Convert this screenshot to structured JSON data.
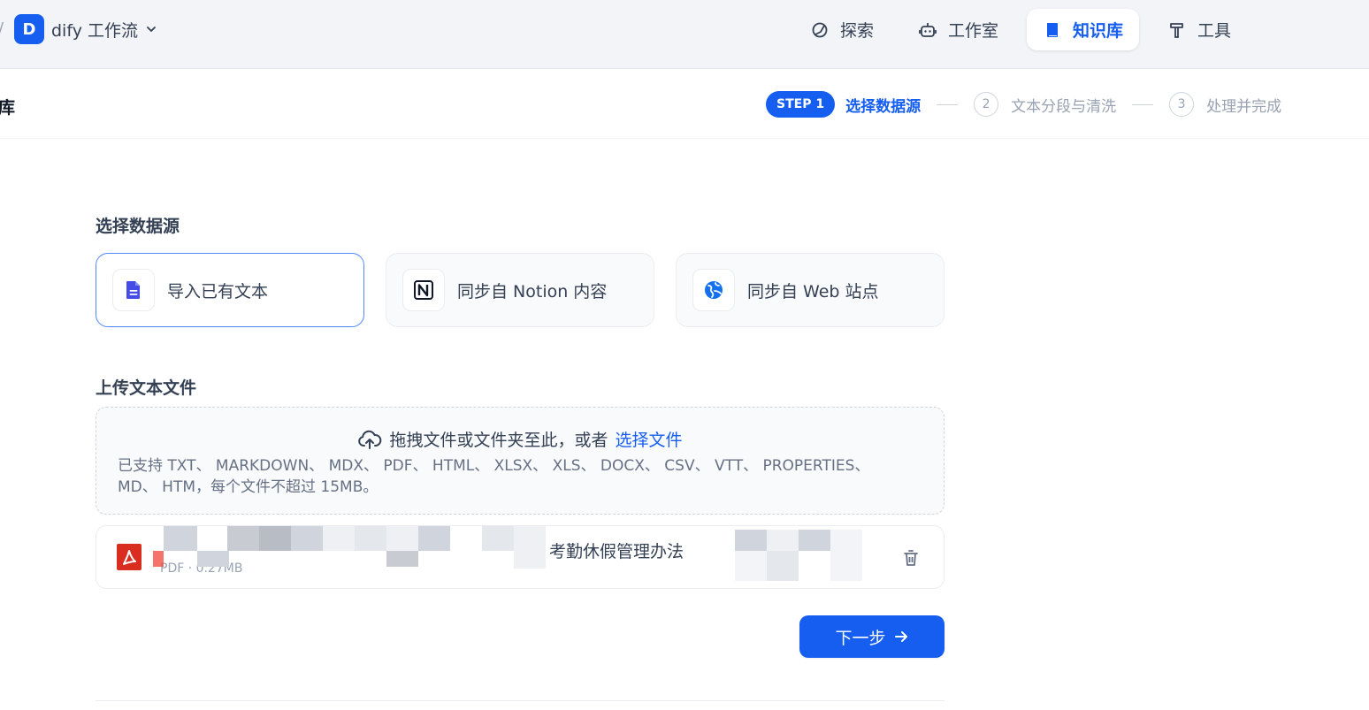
{
  "header": {
    "app_name": "dify 工作流",
    "app_initial": "D",
    "nav": [
      {
        "label": "探索",
        "icon": "compass-icon",
        "active": false
      },
      {
        "label": "工作室",
        "icon": "robot-icon",
        "active": false
      },
      {
        "label": "知识库",
        "icon": "book-icon",
        "active": true
      },
      {
        "label": "工具",
        "icon": "hammer-icon",
        "active": false
      }
    ]
  },
  "subheader": {
    "title_fragment": "库",
    "steps": [
      {
        "badge": "STEP 1",
        "label": "选择数据源",
        "state": "active"
      },
      {
        "number": "2",
        "label": "文本分段与清洗",
        "state": "pending"
      },
      {
        "number": "3",
        "label": "处理并完成",
        "state": "pending"
      }
    ]
  },
  "main": {
    "datasource_title": "选择数据源",
    "sources": [
      {
        "label": "导入已有文本",
        "icon": "file-text-icon",
        "selected": true
      },
      {
        "label": "同步自 Notion 内容",
        "icon": "notion-icon",
        "selected": false
      },
      {
        "label": "同步自 Web 站点",
        "icon": "globe-icon",
        "selected": false
      }
    ],
    "upload_title": "上传文本文件",
    "dropzone": {
      "prompt": "拖拽文件或文件夹至此，或者",
      "link": "选择文件",
      "supported": "已支持 TXT、 MARKDOWN、 MDX、 PDF、 HTML、 XLSX、 XLS、 DOCX、 CSV、 VTT、 PROPERTIES、 MD、 HTM，每个文件不超过 15MB。"
    },
    "file": {
      "name_visible": "考勤休假管理办法",
      "meta": "PDF · 0.27MB"
    },
    "next_button": "下一步"
  },
  "colors": {
    "primary": "#155eef",
    "header_bg": "#f2f4f7",
    "pdf_red": "#d92d20"
  }
}
